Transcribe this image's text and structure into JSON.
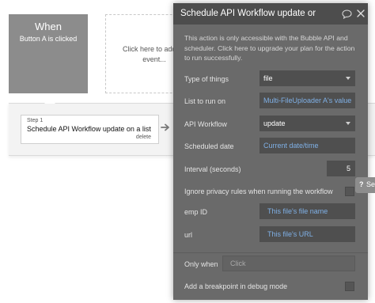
{
  "canvas": {
    "trigger": {
      "title": "When",
      "subtitle": "Button A is clicked"
    },
    "add_event": {
      "line1": "Click here to add an",
      "line2": "event..."
    },
    "step": {
      "label": "Step 1",
      "name": "Schedule API Workflow update on a list",
      "delete_label": "delete"
    }
  },
  "panel": {
    "title": "Schedule API Workflow update or",
    "notice": "This action is only accessible with the Bubble API and scheduler. Click here to upgrade your plan for the action to run successfully.",
    "fields": {
      "type_of_things": {
        "label": "Type of things",
        "value": "file"
      },
      "list_to_run_on": {
        "label": "List to run on",
        "value": "Multi-FileUploader A's value"
      },
      "api_workflow": {
        "label": "API Workflow",
        "value": "update"
      },
      "scheduled_date": {
        "label": "Scheduled date",
        "value": "Current date/time"
      },
      "interval": {
        "label": "Interval (seconds)",
        "value": "5"
      },
      "ignore_privacy": {
        "label": "Ignore privacy rules when running the workflow",
        "checked": false
      },
      "emp_id": {
        "label": "emp ID",
        "value": "This file's file name"
      },
      "url": {
        "label": "url",
        "value": "This file's URL"
      }
    },
    "only_when": {
      "label": "Only when",
      "placeholder": "Click"
    },
    "breakpoint": {
      "label": "Add a breakpoint in debug mode",
      "checked": false
    }
  },
  "help_tab": {
    "icon_text": "?",
    "label": "Se"
  },
  "colors": {
    "panel_bg": "#6a6a6a",
    "header_bg": "#4d4d4d",
    "field_bg": "#4f4f4f",
    "dynamic_text": "#7fb0e6",
    "trigger_bg": "#8c8c8c"
  }
}
